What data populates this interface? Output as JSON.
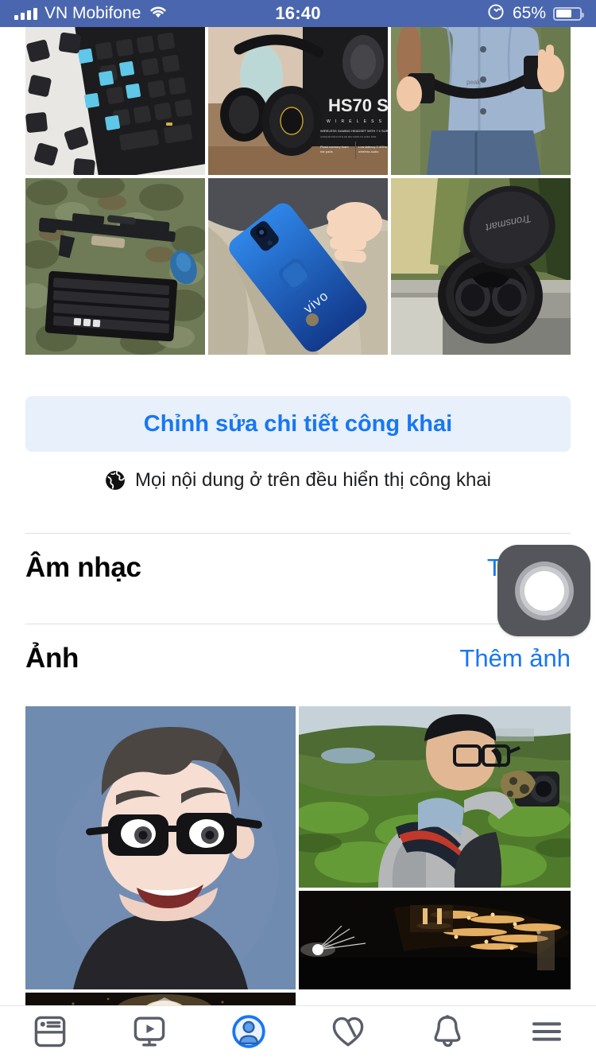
{
  "status_bar": {
    "carrier": "VN Mobifone",
    "time": "16:40",
    "battery_percent": "65%",
    "signal_icon": "signal-bars-icon",
    "wifi_icon": "wifi-icon",
    "rotation_lock_icon": "rotation-lock-icon",
    "battery_icon": "battery-icon",
    "background_color": "#4a66ae"
  },
  "top_photo_grid": {
    "items": [
      {
        "name": "mechanical-keyboard-blue-switches",
        "alt": "Mechanical keyboard with blue switches and loose keycaps on marble"
      },
      {
        "name": "corsair-hs70-headset",
        "alt": "Corsair HS70 wireless headset next to its box with an owl figurine",
        "overlay_text": "HS70 S"
      },
      {
        "name": "camera-strap-held-by-person",
        "alt": "Person in blue shirt holding a black camera strap"
      },
      {
        "name": "airsoft-rifle-and-keyboard",
        "alt": "Airsoft rifle, mouse and keyboard laid on green foliage"
      },
      {
        "name": "vivo-blue-phone-in-pocket",
        "alt": "Blue Vivo phone being placed into a trouser pocket"
      },
      {
        "name": "tronsmart-earbuds-case",
        "alt": "Open Tronsmart wireless earbuds charging case",
        "overlay_text": "Tronsmart"
      }
    ]
  },
  "edit_public_details": {
    "label": "Chỉnh sửa chi tiết công khai",
    "text_color": "#1877f2",
    "background_color": "#e7f0fb"
  },
  "public_note": {
    "icon": "globe-icon",
    "text": "Mọi nội dung ở trên đều hiển thị công khai"
  },
  "sections": [
    {
      "title": "Âm nhạc",
      "action": "Thêm b",
      "action_full": "Thêm bài hát",
      "name": "music"
    },
    {
      "title": "Ảnh",
      "action": "Thêm ảnh",
      "name": "photos"
    }
  ],
  "photos_section": {
    "items": [
      {
        "name": "facebook-avatar-portrait",
        "alt": "Cartoon Facebook avatar of a young man with glasses on blue background"
      },
      {
        "name": "photographer-in-tea-field",
        "alt": "Man in grey striped jacket holding a camera in a green tea plantation"
      },
      {
        "name": "greenhouses-at-night",
        "alt": "Night photo of lit greenhouses on a hillside"
      },
      {
        "name": "dark-light-flare-photo",
        "alt": "Dark photo with a bright light flare, partially visible"
      }
    ]
  },
  "assistive_touch": {
    "name": "assistive-touch-button",
    "background_color": "#54565b"
  },
  "tab_bar": {
    "items": [
      {
        "name": "tab-news-feed",
        "icon": "news-feed-icon",
        "active": false
      },
      {
        "name": "tab-watch",
        "icon": "watch-video-icon",
        "active": false
      },
      {
        "name": "tab-profile",
        "icon": "profile-person-icon",
        "active": true
      },
      {
        "name": "tab-friends",
        "icon": "friends-heart-icon",
        "active": false
      },
      {
        "name": "tab-notifications",
        "icon": "notifications-bell-icon",
        "active": false
      },
      {
        "name": "tab-menu",
        "icon": "hamburger-menu-icon",
        "active": false
      }
    ],
    "active_color": "#1877f2",
    "inactive_color": "#5a5e6b"
  }
}
